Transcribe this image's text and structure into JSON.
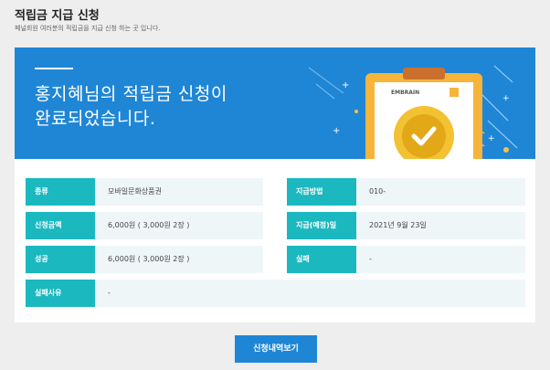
{
  "header": {
    "title": "적립금 지급 신청",
    "description": "페널회원 여러분의 적립금을 지급 신청 하는 곳 입니다."
  },
  "banner": {
    "line1": "홍지혜님의 적립금 신청이",
    "line2": "완료되었습니다.",
    "brand": "EMBRAIN",
    "color": "#1f86d6"
  },
  "info": {
    "label_color": "#1bb8c0",
    "kind_label": "종류",
    "kind_value": "모바일문화상품권",
    "method_label": "지급방법",
    "method_value": "010-",
    "amount_label": "신청금액",
    "amount_value": "6,000원 ( 3,000원 2장 )",
    "date_label": "지급(예정)일",
    "date_value": "2021년 9월 23일",
    "success_label": "성공",
    "success_value": "6,000원 ( 3,000원 2장 )",
    "fail_label": "실패",
    "fail_value": "-",
    "reason_label": "실패사유",
    "reason_value": "-"
  },
  "actions": {
    "history_button": "신청내역보기"
  }
}
